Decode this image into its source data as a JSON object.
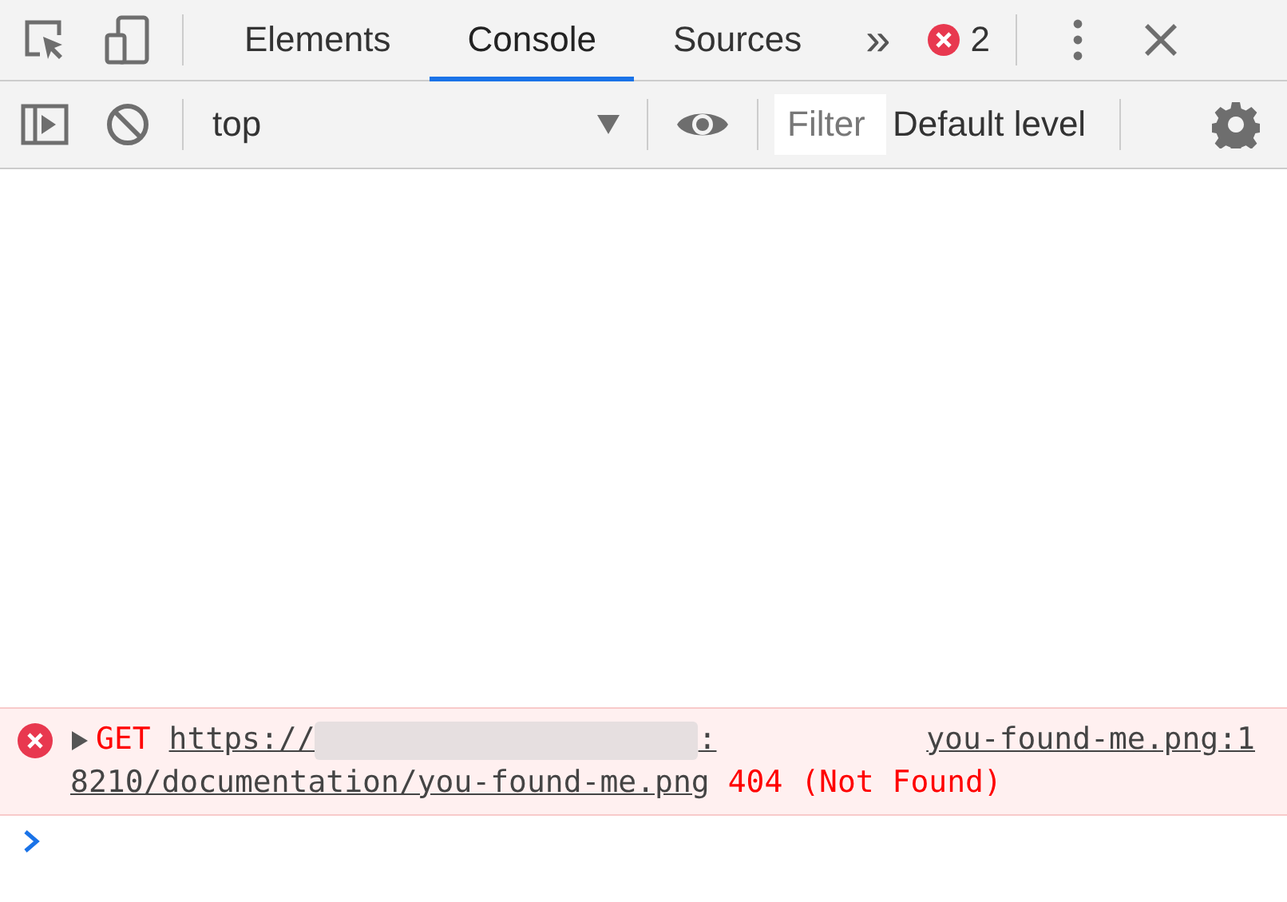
{
  "tabs": [
    {
      "label": "Elements",
      "selected": false
    },
    {
      "label": "Console",
      "selected": true
    },
    {
      "label": "Sources",
      "selected": false
    }
  ],
  "more_tabs": "»",
  "error_count": "2",
  "console_toolbar": {
    "context": "top",
    "filter": {
      "placeholder": "Filter"
    },
    "levels": "Default level"
  },
  "messages": [
    {
      "kind": "error",
      "method": "GET",
      "url_start": "https://",
      "url_end": ":",
      "url_cont": "8210/documentation/you-found-me.png",
      "source": "you-found-me.png:1",
      "status": "404 (Not Found)"
    }
  ]
}
